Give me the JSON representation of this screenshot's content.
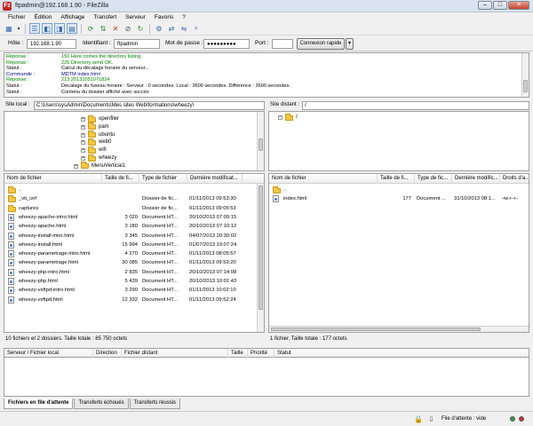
{
  "window": {
    "title": "ftpadmin@192.168.1.90 - FileZilla",
    "logo": "Fz"
  },
  "menu": [
    "Fichier",
    "Édition",
    "Affichage",
    "Transfert",
    "Serveur",
    "Favoris",
    "?"
  ],
  "quickconnect": {
    "host_label": "Hôte :",
    "host_value": "192.168.1.90",
    "user_label": "Identifiant :",
    "user_value": "ftpadmin",
    "pass_label": "Mot de passe :",
    "pass_value": "●●●●●●●●●",
    "port_label": "Port :",
    "port_value": "",
    "connect_label": "Connexion rapide",
    "dropdown_icon": "▾"
  },
  "log": [
    {
      "key": "Réponse :",
      "text": "150 Here comes the directory listing.",
      "color": "green"
    },
    {
      "key": "Réponse :",
      "text": "226 Directory send OK.",
      "color": "green"
    },
    {
      "key": "Statut :",
      "text": "Calcul du décalage horaire du serveur...",
      "color": "black"
    },
    {
      "key": "Commande :",
      "text": "MDTM index.html",
      "color": "blue"
    },
    {
      "key": "Réponse :",
      "text": "213 20131031071824",
      "color": "green"
    },
    {
      "key": "Statut :",
      "text": "Décalage du fuseau horaire : Serveur : 0 secondes. Local : 3600 secondes. Différence : 3600 secondes.",
      "color": "black"
    },
    {
      "key": "Statut :",
      "text": "Contenu du dossier affiché avec succès",
      "color": "black"
    }
  ],
  "local": {
    "path_label": "Site local :",
    "path": "C:\\Users\\sysAdmin\\Documents\\Mes sites Web\\formations\\wheezy\\",
    "tree": [
      "openfiler",
      "pam",
      "ubuntu",
      "web0",
      "wifi",
      "wheezy",
      "MenuVertical1"
    ],
    "columns": [
      "Nom de fichier",
      "Taille de fi...",
      "Type de fichier",
      "Dernière modificat..."
    ],
    "files": [
      {
        "name": "..",
        "size": "",
        "type": "",
        "date": "",
        "kind": "folder"
      },
      {
        "name": "_vti_cnf",
        "size": "",
        "type": "Dossier de fic...",
        "date": "01/11/2013 09:53:30",
        "kind": "folder"
      },
      {
        "name": "captures",
        "size": "",
        "type": "Dossier de fic...",
        "date": "01/11/2013 09:05:53",
        "kind": "folder"
      },
      {
        "name": "wheezy-apache-intro.html",
        "size": "3 020",
        "type": "Document HT...",
        "date": "20/10/2013 07:09:15",
        "kind": "file"
      },
      {
        "name": "wheezy-apache.html",
        "size": "3 180",
        "type": "Document HT...",
        "date": "20/10/2013 07:10:12",
        "kind": "file"
      },
      {
        "name": "wheezy-install-intro.html",
        "size": "3 345",
        "type": "Document HT...",
        "date": "04/07/2013 20:30:02",
        "kind": "file"
      },
      {
        "name": "wheezy-install.html",
        "size": "15 994",
        "type": "Document HT...",
        "date": "01/07/2013 19:07:24",
        "kind": "file"
      },
      {
        "name": "wheezy-parametrage-intro.html",
        "size": "4 270",
        "type": "Document HT...",
        "date": "01/11/2013 08:05:57",
        "kind": "file"
      },
      {
        "name": "wheezy-parametrage.html",
        "size": "30 085",
        "type": "Document HT...",
        "date": "01/11/2013 09:53:20",
        "kind": "file"
      },
      {
        "name": "wheezy-php-intro.html",
        "size": "2 835",
        "type": "Document HT...",
        "date": "20/10/2013 07:14:08",
        "kind": "file"
      },
      {
        "name": "wheezy-php.html",
        "size": "5 439",
        "type": "Document HT...",
        "date": "20/10/2013 10:01:43",
        "kind": "file"
      },
      {
        "name": "wheezy-vsftpd-intro.html",
        "size": "3 290",
        "type": "Document HT...",
        "date": "01/11/2013 10:02:10",
        "kind": "file"
      },
      {
        "name": "wheezy-vsftpd.html",
        "size": "12 332",
        "type": "Document HT...",
        "date": "01/11/2013 09:52:24",
        "kind": "file"
      }
    ],
    "status": "10 fichiers et 2 dossiers. Taille totale : 85 750 octets"
  },
  "remote": {
    "path_label": "Site distant :",
    "path": "/",
    "tree": [
      "/"
    ],
    "columns": [
      "Nom de fichier",
      "Taille de fi...",
      "Type de fic...",
      "Dernière modific...",
      "Droits d'a..."
    ],
    "files": [
      {
        "name": "..",
        "size": "",
        "type": "",
        "date": "",
        "perms": "",
        "kind": "folder"
      },
      {
        "name": "index.html",
        "size": "177",
        "type": "Document ...",
        "date": "31/10/2013 08:1...",
        "perms": "-rw-r--r--",
        "kind": "file"
      }
    ],
    "status": "1 fichier. Taille totale : 177 octets"
  },
  "queue": {
    "columns": [
      "Serveur / Fichier local",
      "Direction",
      "Fichier distant",
      "Taille",
      "Priorité",
      "Statut"
    ],
    "tabs": [
      "Fichiers en file d'attente",
      "Transferts échoués",
      "Transferts réussis"
    ]
  },
  "statusbar": {
    "queue_text": "File d'attente : vide"
  }
}
